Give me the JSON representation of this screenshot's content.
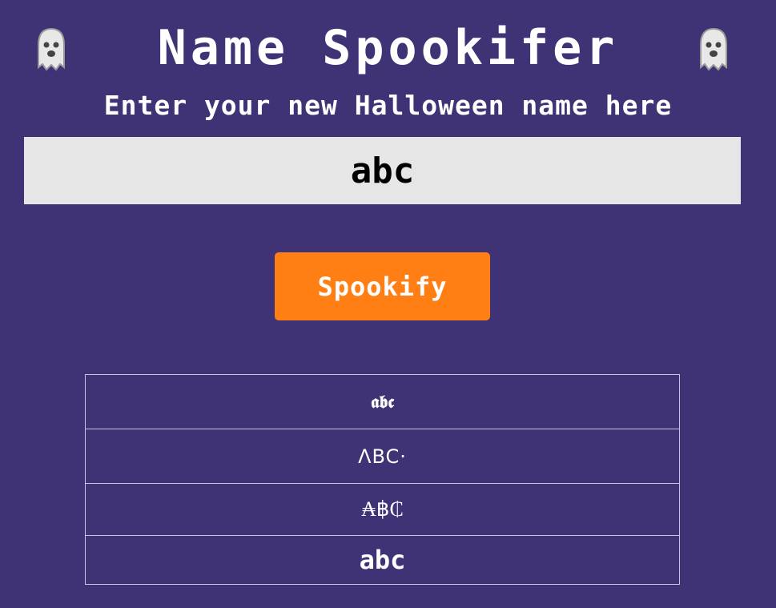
{
  "header": {
    "title": "Name Spookifer",
    "left_icon": "ghost-icon",
    "right_icon": "ghost-icon",
    "subtitle": "Enter your new Halloween name here"
  },
  "input": {
    "value": "abc"
  },
  "button": {
    "label": "Spookify",
    "color": "#ff7f14"
  },
  "results": [
    "𝖆𝖇𝖈",
    "ΛBC·",
    "₳฿₵",
    "abc"
  ],
  "colors": {
    "background": "#3f3376",
    "input_bg": "#e6e6e6",
    "text": "#ffffff"
  }
}
